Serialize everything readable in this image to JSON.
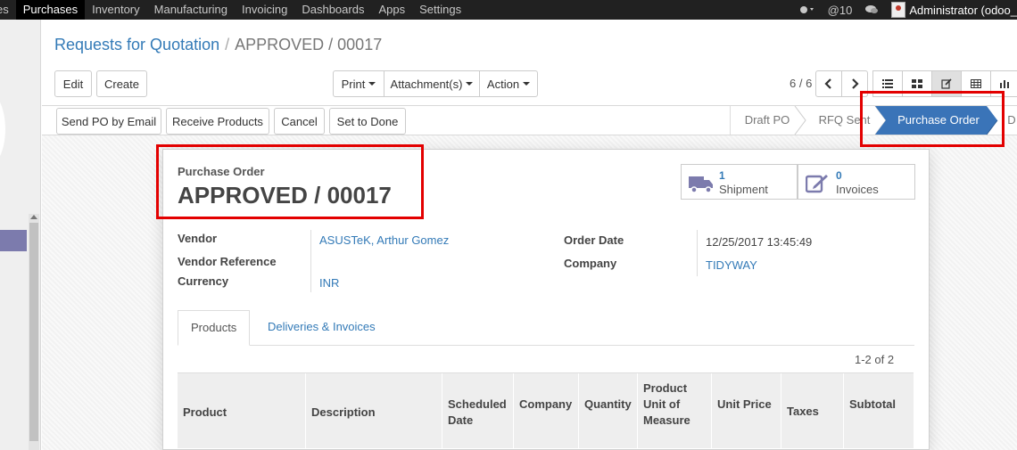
{
  "topbar": {
    "menu": [
      "es",
      "Purchases",
      "Inventory",
      "Manufacturing",
      "Invoicing",
      "Dashboards",
      "Apps",
      "Settings"
    ],
    "active_index": 1,
    "messages_count": "@10",
    "user": "Administrator (odoo_"
  },
  "control_panel": {
    "breadcrumb_parent": "Requests for Quotation",
    "breadcrumb_separator": "/",
    "breadcrumb_current": "APPROVED / 00017",
    "edit_label": "Edit",
    "create_label": "Create",
    "print_label": "Print",
    "attachments_label": "Attachment(s)",
    "action_label": "Action",
    "pager": "6 / 6"
  },
  "statusbar": {
    "buttons": [
      "Send PO by Email",
      "Receive Products",
      "Cancel",
      "Set to Done"
    ],
    "stages": [
      "Draft PO",
      "RFQ Sent",
      "Purchase Order",
      "D"
    ],
    "active_stage": "Purchase Order"
  },
  "form": {
    "doc_type": "Purchase Order",
    "doc_name": "APPROVED / 00017",
    "smart_buttons": [
      {
        "count": "1",
        "label": "Shipment",
        "icon": "truck-icon"
      },
      {
        "count": "0",
        "label": "Invoices",
        "icon": "edit-icon"
      }
    ],
    "left_fields": [
      {
        "label": "Vendor",
        "value": "ASUSTeK, Arthur Gomez"
      },
      {
        "label": "Vendor Reference",
        "value": ""
      },
      {
        "label": "Currency",
        "value": "INR"
      }
    ],
    "right_fields": [
      {
        "label": "Order Date",
        "value": "12/25/2017 13:45:49"
      },
      {
        "label": "Company",
        "value": "TIDYWAY"
      }
    ],
    "tabs": [
      "Products",
      "Deliveries & Invoices"
    ],
    "record_count": "1-2 of 2",
    "columns": [
      "Product",
      "Description",
      "Scheduled Date",
      "Company",
      "Quantity",
      "Product Unit of Measure",
      "Unit Price",
      "Taxes",
      "Subtotal"
    ]
  },
  "colors": {
    "topbar": "#212121",
    "link": "#337ab7",
    "active_stage": "#3a74b8",
    "highlight": "#e30000"
  }
}
